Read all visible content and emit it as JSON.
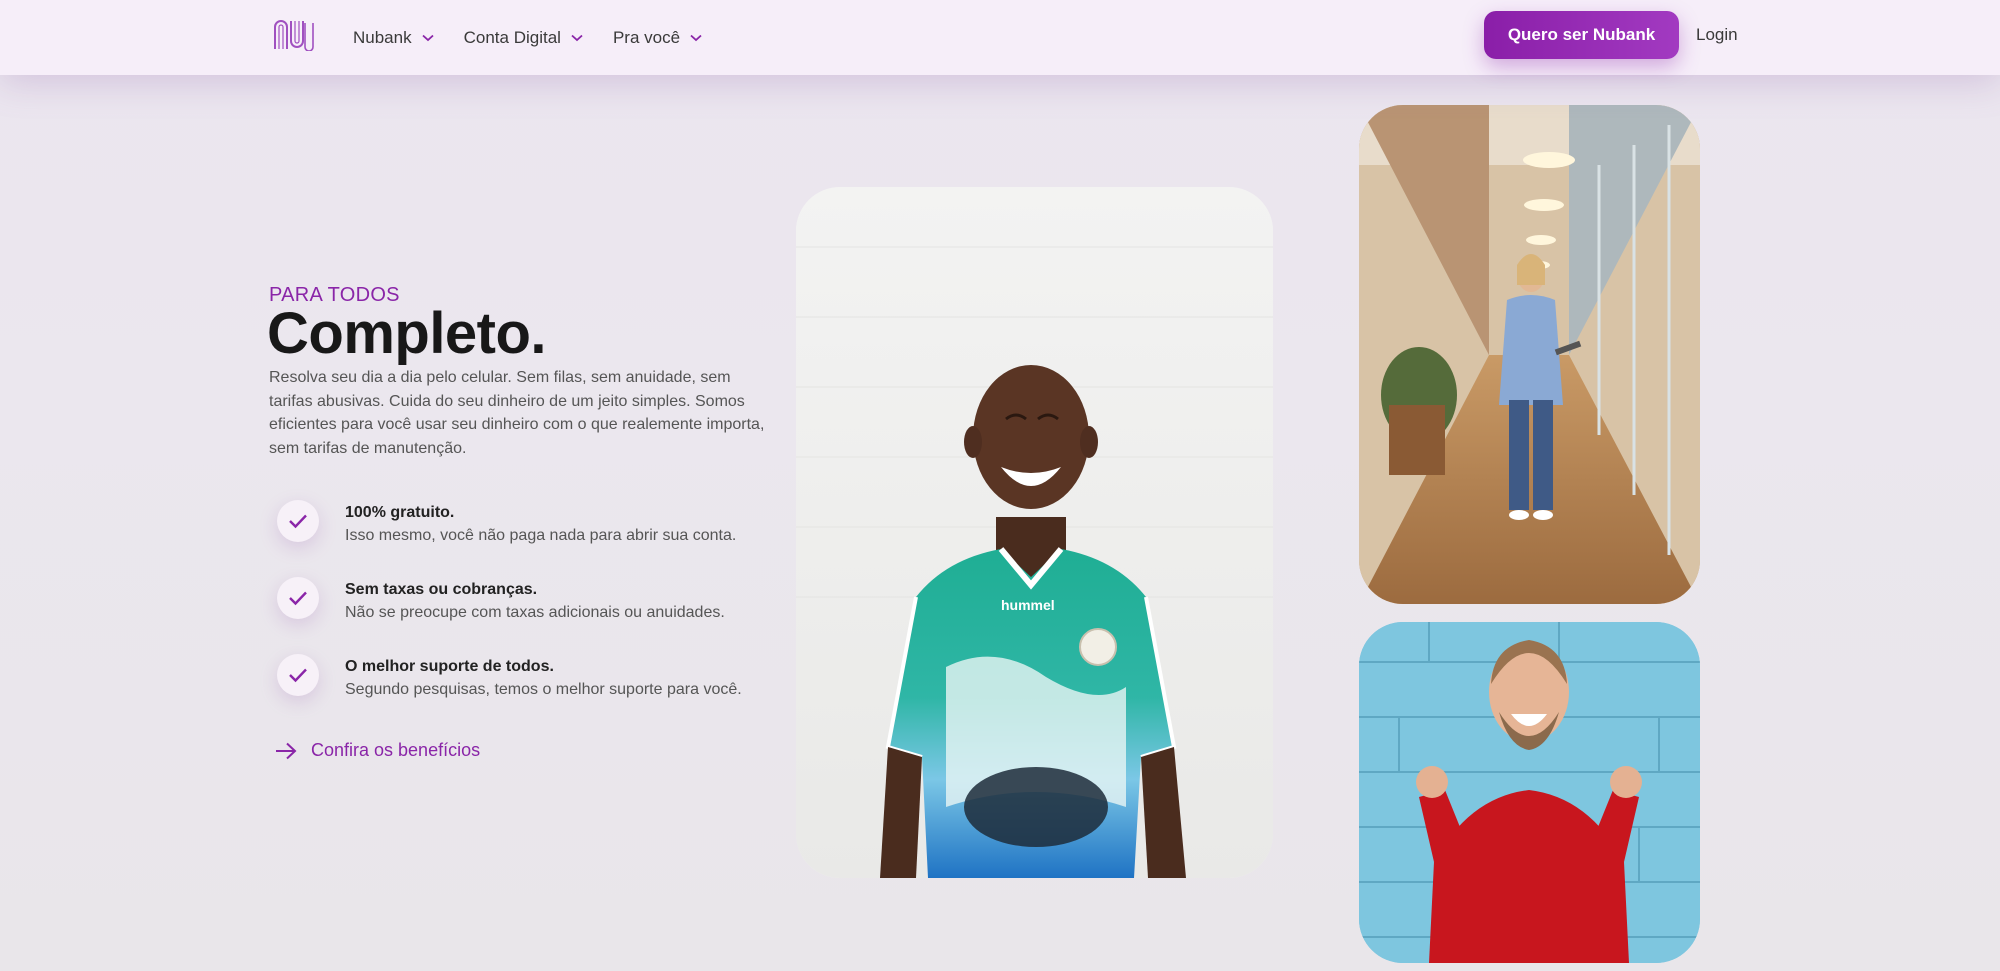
{
  "header": {
    "logo_icon": "nubank-logo-icon",
    "nav": [
      {
        "label": "Nubank"
      },
      {
        "label": "Conta Digital"
      },
      {
        "label": "Pra você"
      }
    ],
    "cta_label": "Quero ser Nubank",
    "login_label": "Login"
  },
  "hero": {
    "eyebrow": "PARA TODOS",
    "title": "Completo.",
    "description": "Resolva seu dia a dia pelo celular. Sem filas, sem anuidade, sem tarifas abusivas. Cuida do seu dinheiro de um jeito simples. Somos eficientes para você usar seu dinheiro com o que realemente importa, sem tarifas de manutenção.",
    "features": [
      {
        "title": "100% gratuito.",
        "desc": "Isso mesmo, você não paga nada para abrir sua conta.",
        "icon": "check-icon"
      },
      {
        "title": "Sem taxas ou cobranças.",
        "desc": "Não se preocupe com taxas adicionais ou anuidades.",
        "icon": "check-icon"
      },
      {
        "title": "O melhor suporte de todos.",
        "desc": "Segundo pesquisas, temos o melhor suporte para você.",
        "icon": "check-icon"
      }
    ],
    "link_label": "Confira os benefícios",
    "link_icon": "arrow-right-icon"
  },
  "colors": {
    "brand": "#8a25a8",
    "header_bg": "#f6eef9",
    "page_bg": "#ebe6ee"
  }
}
